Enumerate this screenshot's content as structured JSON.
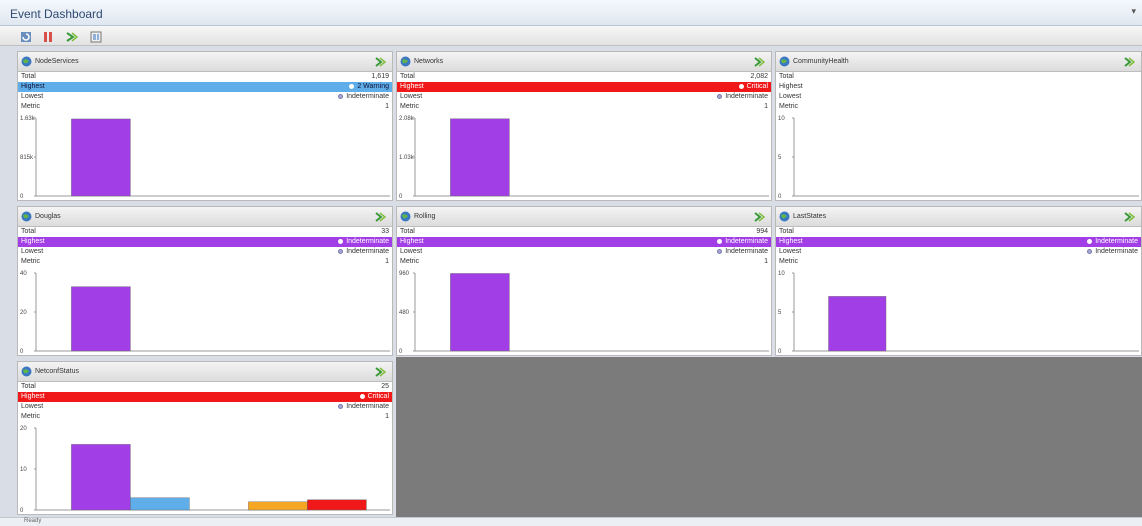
{
  "window": {
    "title": "Event Dashboard",
    "collapse_icon": "chevron-down-icon"
  },
  "toolbar": {
    "buttons": [
      {
        "icon": "refresh-icon"
      },
      {
        "icon": "pause-icon"
      },
      {
        "icon": "drill-down-icon"
      },
      {
        "icon": "layout-icon"
      }
    ]
  },
  "labels": {
    "total": "Total",
    "highest": "Highest",
    "lowest": "Lowest",
    "metric": "Metric"
  },
  "severity_colors": {
    "critical": "#f01818",
    "warning": "#5faee9",
    "indeterminate": "#a23ee6",
    "minor": "#f5a623"
  },
  "panels": [
    {
      "title": "NodeServices",
      "total": "1,619",
      "highest": "2 Warning",
      "highest_color": "#5faee9",
      "lowest": "Indeterminate",
      "metric": "1",
      "chart_data": {
        "type": "bar",
        "yticks": [
          "1.63k",
          "815k",
          "0"
        ],
        "ylim": [
          0,
          1630
        ],
        "categories": [
          "Indeterminate",
          "Warning",
          "Minor",
          "Major",
          "Critical"
        ],
        "series": [
          {
            "values": [
              1610,
              0,
              0,
              0,
              0
            ]
          }
        ]
      }
    },
    {
      "title": "Networks",
      "total": "2,082",
      "highest": "Critical",
      "highest_color": "#f01818",
      "lowest": "Indeterminate",
      "metric": "1",
      "chart_data": {
        "type": "bar",
        "yticks": [
          "2.08k",
          "1.03k",
          "0"
        ],
        "ylim": [
          0,
          2080
        ],
        "categories": [
          "Indeterminate",
          "Warning",
          "Minor",
          "Major",
          "Critical"
        ],
        "series": [
          {
            "values": [
              2060,
              0,
              0,
              0,
              0
            ]
          }
        ]
      }
    },
    {
      "title": "CommunityHealth",
      "total": "",
      "highest": "",
      "highest_color": "",
      "lowest": "",
      "metric": "",
      "chart_data": {
        "type": "bar",
        "yticks": [
          "10",
          "5",
          "0"
        ],
        "ylim": [
          0,
          10
        ],
        "categories": [
          "Indeterminate",
          "Warning",
          "Minor",
          "Major",
          "Critical"
        ],
        "series": [
          {
            "values": [
              0,
              0,
              0,
              0,
              0
            ]
          }
        ]
      }
    },
    {
      "title": "Douglas",
      "total": "33",
      "highest": "Indeterminate",
      "highest_color": "#a23ee6",
      "lowest": "Indeterminate",
      "metric": "1",
      "chart_data": {
        "type": "bar",
        "yticks": [
          "40",
          "20",
          "0"
        ],
        "ylim": [
          0,
          40
        ],
        "categories": [
          "Indeterminate",
          "Warning",
          "Minor",
          "Major",
          "Critical"
        ],
        "series": [
          {
            "values": [
              33,
              0,
              0,
              0,
              0
            ]
          }
        ]
      }
    },
    {
      "title": "Rolling",
      "total": "994",
      "highest": "Indeterminate",
      "highest_color": "#a23ee6",
      "lowest": "Indeterminate",
      "metric": "1",
      "chart_data": {
        "type": "bar",
        "yticks": [
          "960",
          "480",
          "0"
        ],
        "ylim": [
          0,
          1000
        ],
        "categories": [
          "Indeterminate",
          "Warning",
          "Minor",
          "Major",
          "Critical"
        ],
        "series": [
          {
            "values": [
              994,
              0,
              0,
              0,
              0
            ]
          }
        ]
      }
    },
    {
      "title": "LastStates",
      "total": "",
      "highest": "Indeterminate",
      "highest_color": "#a23ee6",
      "lowest": "Indeterminate",
      "metric": "",
      "chart_data": {
        "type": "bar",
        "yticks": [
          "10",
          "5",
          "0"
        ],
        "ylim": [
          0,
          10
        ],
        "categories": [
          "Indeterminate",
          "Warning",
          "Minor",
          "Major",
          "Critical"
        ],
        "series": [
          {
            "values": [
              7,
              0,
              0,
              0,
              0
            ]
          }
        ]
      }
    },
    {
      "title": "NetconfStatus",
      "total": "25",
      "highest": "Critical",
      "highest_color": "#f01818",
      "lowest": "Indeterminate",
      "metric": "1",
      "chart_data": {
        "type": "bar",
        "yticks": [
          "20",
          "10",
          "0"
        ],
        "ylim": [
          0,
          20
        ],
        "categories": [
          "Indeterminate",
          "Warning",
          "Minor",
          "Major",
          "Critical"
        ],
        "series": [
          {
            "values": [
              16,
              3,
              0,
              2,
              2.5
            ]
          }
        ]
      }
    }
  ],
  "statusbar": {
    "left": "Ready",
    "right": ""
  }
}
